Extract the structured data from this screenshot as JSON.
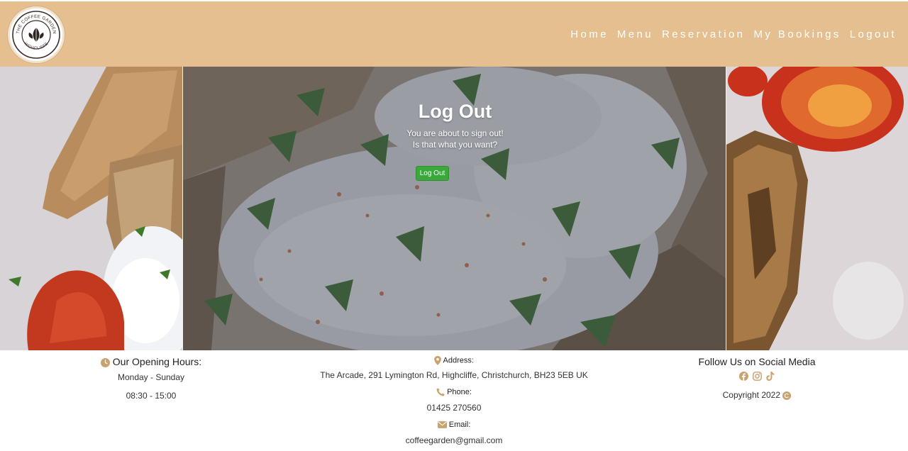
{
  "brand": {
    "logo_top": "THE COFFEE GARDEN",
    "logo_bottom": "HIGHCLIFFE"
  },
  "nav": {
    "items": [
      "Home",
      "Menu",
      "Reservation",
      "My Bookings",
      "Logout"
    ]
  },
  "logout": {
    "title": "Log Out",
    "line1": "You are about to sign out!",
    "line2": "Is that what you want?",
    "button_label": "Log Out"
  },
  "footer": {
    "hours": {
      "heading": "Our Opening Hours:",
      "days": "Monday - Sunday",
      "times": "08:30 - 15:00"
    },
    "contact": {
      "address_label": "Address:",
      "address": "The Arcade, 291 Lymington Rd, Highcliffe, Christchurch, BH23 5EB UK",
      "phone_label": "Phone:",
      "phone": "01425 270560",
      "email_label": "Email:",
      "email": "coffeegarden@gmail.com"
    },
    "social": {
      "heading": "Follow Us on Social Media",
      "icons": [
        "facebook-icon",
        "instagram-icon",
        "tiktok-icon"
      ],
      "copyright": "Copyright 2022"
    }
  },
  "colors": {
    "navbar": "#e5bf90",
    "accent_gold": "#c9a26e",
    "button_green": "#3aa83a"
  }
}
